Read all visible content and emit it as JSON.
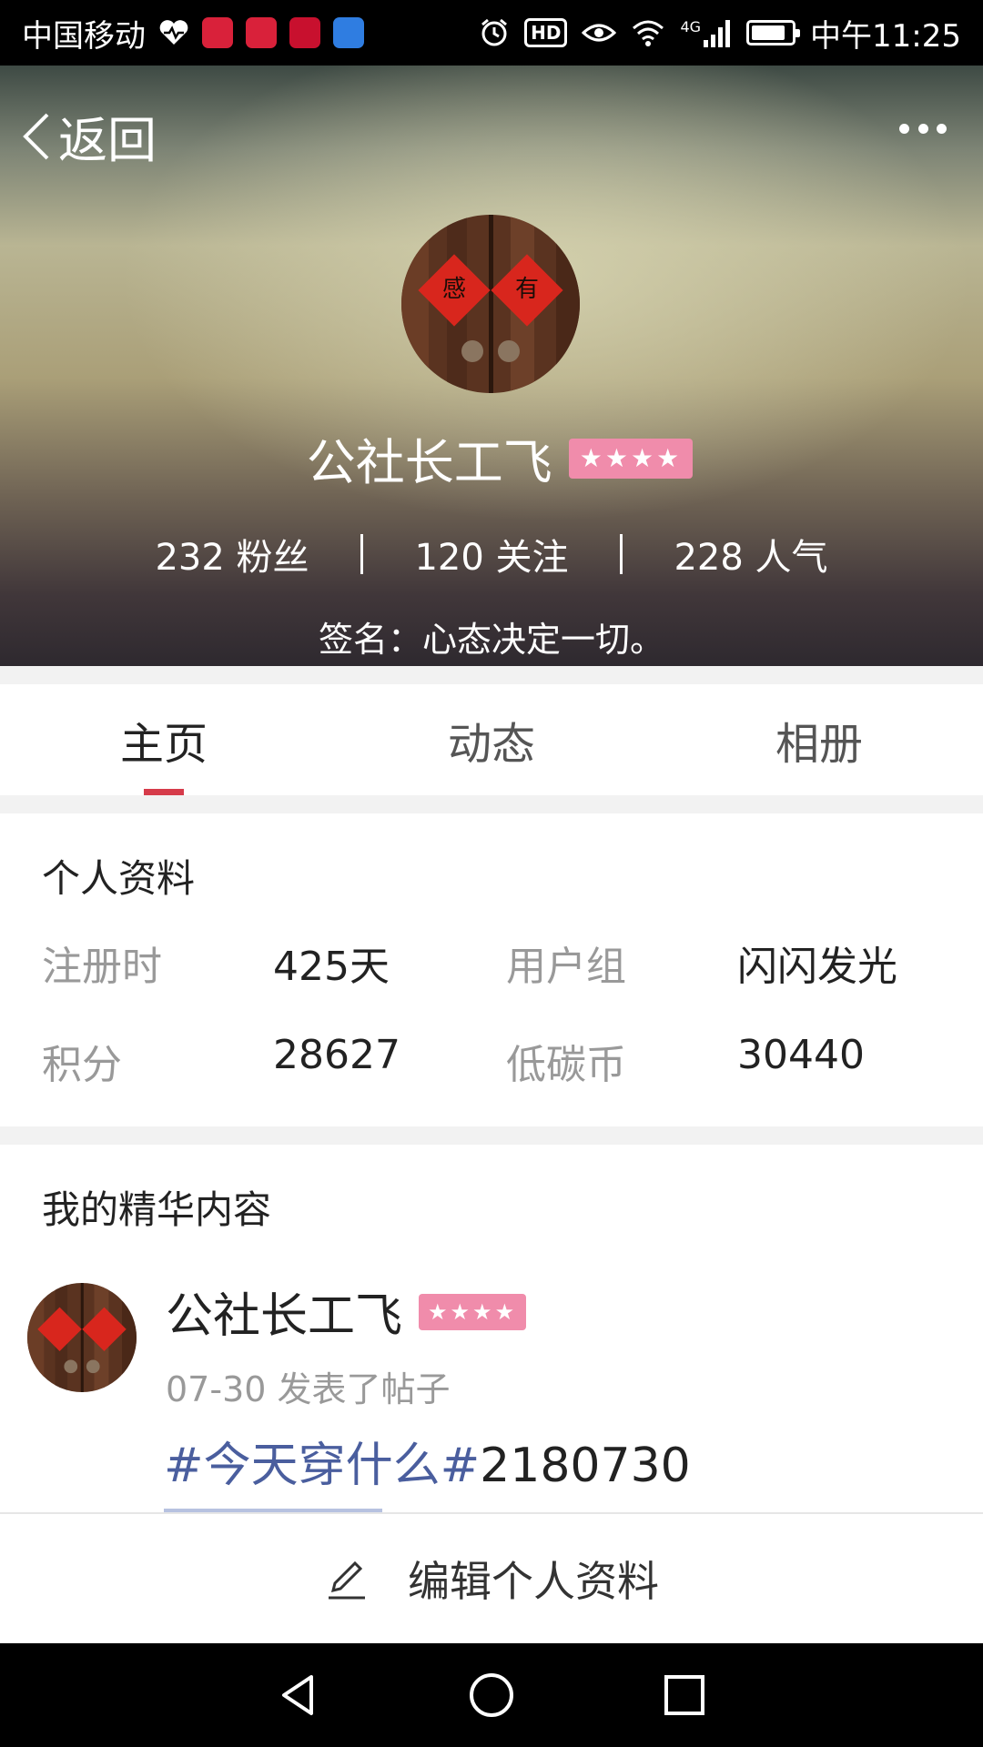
{
  "status_bar": {
    "carrier": "中国移动",
    "network": "4G",
    "hd": "HD",
    "time": "中午11:25",
    "battery_level": 0.85,
    "app_icon_colors": [
      "#d9213a",
      "#d9213a",
      "#c8102e",
      "#2f7de1"
    ]
  },
  "header": {
    "back_label": "返回",
    "more_icon": "more-dots-icon",
    "username": "公社长工飞",
    "stars": "★★★★",
    "stats": [
      {
        "count": "232",
        "label": "粉丝"
      },
      {
        "count": "120",
        "label": "关注"
      },
      {
        "count": "228",
        "label": "人气"
      }
    ],
    "signature": "签名：心态决定一切。"
  },
  "tabs": [
    {
      "label": "主页",
      "active": true
    },
    {
      "label": "动态",
      "active": false
    },
    {
      "label": "相册",
      "active": false
    }
  ],
  "profile": {
    "title": "个人资料",
    "rows": [
      [
        {
          "label": "注册时",
          "value": "425天"
        },
        {
          "label": "用户组",
          "value": "闪闪发光"
        }
      ],
      [
        {
          "label": "积分",
          "value": "28627"
        },
        {
          "label": "低碳币",
          "value": "30440"
        }
      ]
    ]
  },
  "featured": {
    "title": "我的精华内容",
    "post": {
      "author": "公社长工飞",
      "stars": "★★★★",
      "meta": "07-30 发表了帖子",
      "hashtag": "#今天穿什么#",
      "text_suffix": "2180730"
    }
  },
  "edit_bar": {
    "label": "编辑个人资料",
    "icon": "pencil-icon"
  },
  "colors": {
    "accent": "#d63b4a",
    "badge": "#f08cab",
    "hashtag": "#4a5e9e"
  }
}
